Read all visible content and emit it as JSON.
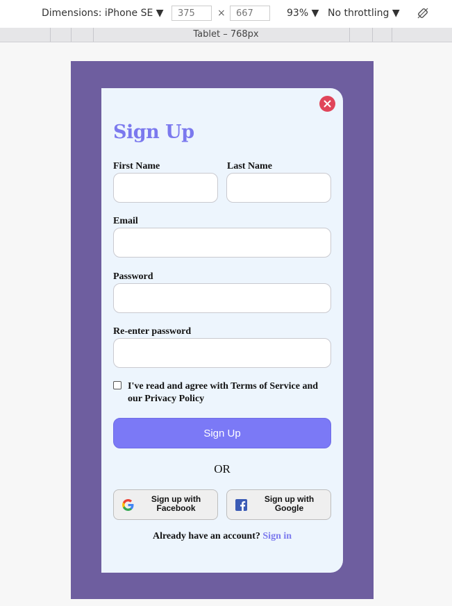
{
  "devtools": {
    "dimensions_label": "Dimensions: iPhone SE ▼",
    "width": "375",
    "height": "667",
    "times": "×",
    "zoom": "93% ▼",
    "throttling": "No throttling ▼",
    "breakpoint_label": "Tablet – 768px"
  },
  "form": {
    "title": "Sign Up",
    "first_name_label": "First Name",
    "last_name_label": "Last Name",
    "email_label": "Email",
    "password_label": "Password",
    "reenter_label": "Re-enter password",
    "agree_text": "I've read and agree with Terms of Service and our Privacy Policy",
    "agree_checked": false,
    "signup_button": "Sign Up",
    "or_text": "OR",
    "social_left": "Sign up with Facebook",
    "social_right": "Sign up with Google",
    "footer_text": "Already have an account?",
    "footer_link": "Sign in"
  },
  "colors": {
    "viewport_bg": "#6e5e9f",
    "card_bg": "#edf5fd",
    "accent": "#7b79ee",
    "close": "#e0455a"
  },
  "icons": {
    "close": "close-icon",
    "google": "google-icon",
    "facebook": "facebook-icon",
    "rotate": "rotate-icon"
  }
}
